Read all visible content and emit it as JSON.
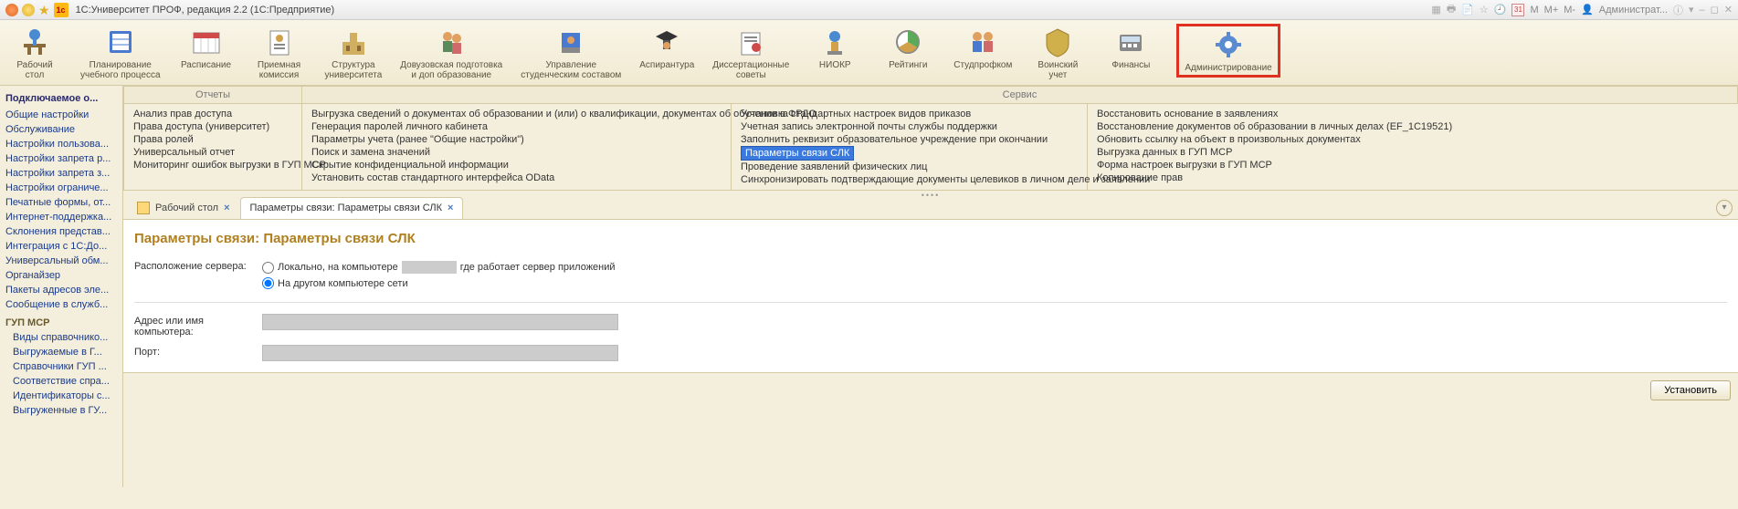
{
  "titlebar": {
    "title": "1С:Университет ПРОФ, редакция 2.2  (1С:Предприятие)",
    "cal": "31",
    "m": "M",
    "mplus": "M+",
    "mminus": "M-",
    "user": "Администрат..."
  },
  "toolbar": [
    {
      "id": "desk",
      "label": "Рабочий\nстол"
    },
    {
      "id": "plan",
      "label": "Планирование\nучебного процесса"
    },
    {
      "id": "sched",
      "label": "Расписание"
    },
    {
      "id": "adm",
      "label": "Приемная\nкомиссия"
    },
    {
      "id": "struct",
      "label": "Структура\nуниверситета"
    },
    {
      "id": "dovuz",
      "label": "Довузовская подготовка\nи доп образование"
    },
    {
      "id": "stud",
      "label": "Управление\nстуденческим составом"
    },
    {
      "id": "asp",
      "label": "Аспирантура"
    },
    {
      "id": "diss",
      "label": "Диссертационные\nсоветы"
    },
    {
      "id": "niokr",
      "label": "НИОКР"
    },
    {
      "id": "rate",
      "label": "Рейтинги"
    },
    {
      "id": "prof",
      "label": "Студпрофком"
    },
    {
      "id": "mil",
      "label": "Воинский\nучет"
    },
    {
      "id": "fin",
      "label": "Финансы"
    },
    {
      "id": "admin",
      "label": "Администрирование"
    }
  ],
  "left_panel": {
    "title": "Подключаемое о...",
    "links": [
      "Общие настройки",
      "Обслуживание",
      "Настройки пользова...",
      "Настройки запрета р...",
      "Настройки запрета з...",
      "Настройки ограниче...",
      "Печатные формы, от...",
      "Интернет-поддержка...",
      "Склонения представ...",
      "Интеграция с 1С:До...",
      "Универсальный обм...",
      "Органайзер",
      "Пакеты адресов эле...",
      "Сообщение в служб..."
    ],
    "section": "ГУП МСР",
    "sublinks": [
      "Виды справочнико...",
      "Выгружаемые в Г...",
      "Справочники ГУП ...",
      "Соответствие спра...",
      "Идентификаторы с...",
      "Выгруженные в ГУ..."
    ]
  },
  "serv_headers": {
    "reports": "Отчеты",
    "service": "Сервис"
  },
  "reports_col": [
    "Анализ прав доступа",
    "Права доступа (университет)",
    "Права ролей",
    "Универсальный отчет",
    "Мониторинг ошибок выгрузки в ГУП МСР"
  ],
  "service_cols": [
    [
      "Выгрузка сведений о документах об образовании и (или) о квалификации, документах об обучении в ФРДО",
      "Генерация паролей личного кабинета",
      "Параметры учета (ранее \"Общие настройки\")",
      "Поиск и замена значений",
      "Скрытие конфиденциальной информации",
      "Установить состав стандартного интерфейса OData"
    ],
    [
      "Установка стандартных настроек видов приказов",
      "Учетная запись электронной почты службы поддержки",
      "Заполнить реквизит образовательное учреждение при окончании",
      "Параметры связи СЛК",
      "Проведение заявлений физических лиц",
      "Синхронизировать подтверждающие документы целевиков в личном деле и заявлении"
    ],
    [
      "Восстановить основание в заявлениях",
      "Восстановление документов об образовании в личных делах (EF_1C19521)",
      "Обновить ссылку на объект в произвольных документах",
      "Выгрузка данных в ГУП МСР",
      "Форма настроек выгрузки в ГУП МСР",
      "Копирование прав"
    ]
  ],
  "tabs": {
    "home": "Рабочий стол",
    "active": "Параметры связи: Параметры связи СЛК"
  },
  "page": {
    "title": "Параметры связи: Параметры связи СЛК",
    "loc_label": "Расположение сервера:",
    "radio1_a": "Локально, на компьютере",
    "radio1_b": "где работает сервер приложений",
    "radio2": "На другом компьютере сети",
    "addr_label": "Адрес или имя компьютера:",
    "port_label": "Порт:",
    "install_btn": "Установить"
  }
}
